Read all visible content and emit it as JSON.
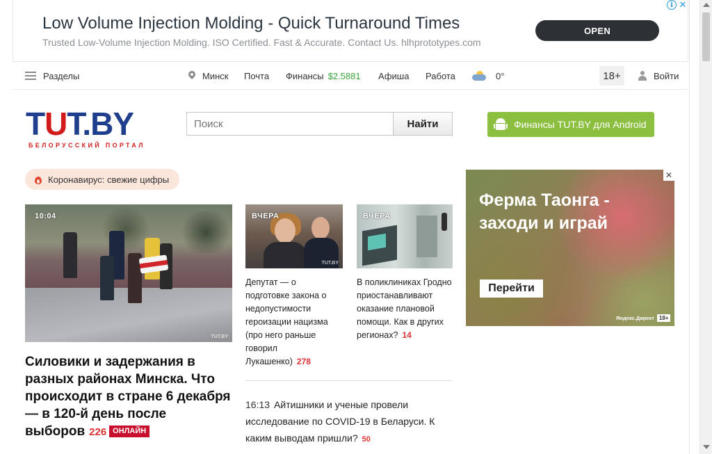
{
  "top_ad": {
    "title": "Low Volume Injection Molding - Quick Turnaround Times",
    "subtitle": "Trusted Low-Volume Injection Molding. ISO Certified. Fast & Accurate. Contact Us. hlhprototypes.com",
    "cta": "OPEN",
    "info_icon": "i",
    "close_icon": "✕"
  },
  "nav": {
    "sections_label": "Разделы",
    "city": "Минск",
    "mail": "Почта",
    "finance_label": "Финансы",
    "finance_value": "$2.5881",
    "afisha": "Афиша",
    "job": "Работа",
    "weather": "0°",
    "age": "18+",
    "login": "Войти"
  },
  "logo": {
    "main_t": "T",
    "main_u": "U",
    "main_rest": "T.BY",
    "tagline": "БЕЛОРУССКИЙ ПОРТАЛ"
  },
  "search": {
    "placeholder": "Поиск",
    "button": "Найти"
  },
  "android_button": "Финансы TUT.BY для Android",
  "corona_pill": "Коронавирус: свежие цифры",
  "main_story": {
    "time": "10:04",
    "watermark": "TUT.BY",
    "headline": "Силовики и задержания в разных районах Минска. Что происходит в стране 6 декабря — в 120-й день после выборов",
    "count": "226",
    "badge": "ОНЛАЙН"
  },
  "story2": {
    "tag": "ВЧЕРА",
    "watermark": "TUT.BY",
    "text": "Депутат — о подготовке закона о недопустимости героизации нацизма (про него раньше говорил Лукашенко)",
    "count": "278"
  },
  "story3": {
    "tag": "ВЧЕРА",
    "text": "В поликлиниках Гродно приостанавливают оказание плановой помощи. Как в других регионах?",
    "count": "14"
  },
  "feed": {
    "time": "16:13",
    "text": "Айтишники и ученые провели исследование по COVID-19 в Беларуси. К каким выводам пришли?",
    "count": "50"
  },
  "right_ad": {
    "title_line1": "Ферма Таонга -",
    "title_line2": "заходи и играй",
    "cta": "Перейти",
    "close": "✕",
    "footer": "Яндекс.Директ",
    "age": "18+"
  },
  "colors": {
    "logo_blue": "#1f3f8e",
    "logo_red": "#d21c1c",
    "finance_green": "#3aa53a",
    "count_red": "#d33333",
    "android_green": "#8cbf3f",
    "online_badge": "#c8102e"
  }
}
